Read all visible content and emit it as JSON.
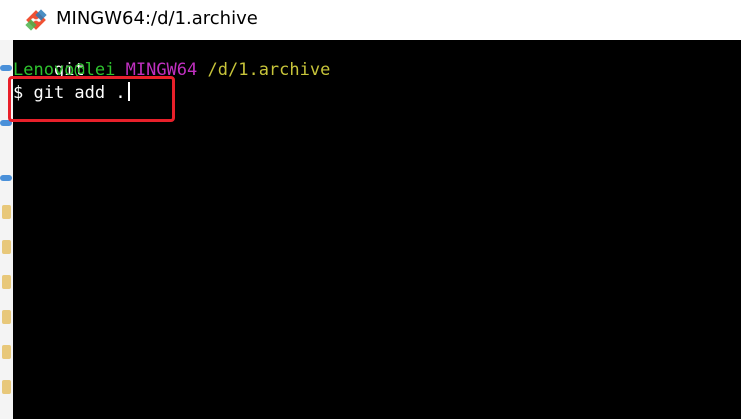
{
  "window": {
    "title": "MINGW64:/d/1.archive",
    "icon": "git-icon"
  },
  "terminal": {
    "line1": "git",
    "prompt": {
      "user_host": "Lenovo@lei",
      "shell": "MINGW64",
      "path": "/d/1.archive"
    },
    "command_line": "$ git add ."
  },
  "colors": {
    "terminal_bg": "#000000",
    "prompt_user": "#2ec22e",
    "prompt_shell": "#c030c0",
    "prompt_path": "#c7c43a",
    "highlight": "#e8202a"
  }
}
